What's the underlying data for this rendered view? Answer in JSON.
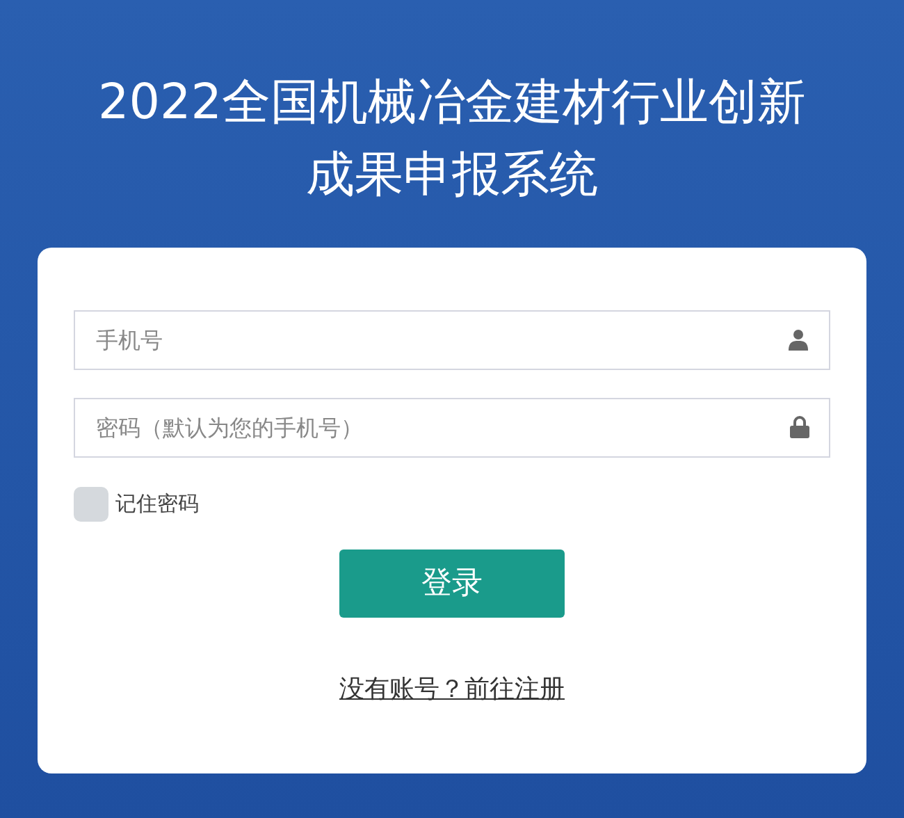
{
  "title_lines": [
    "2022全国机械冶金建材行业创新",
    "成果申报系统"
  ],
  "fields": [
    {
      "placeholder": "手机号",
      "kind": "user"
    },
    {
      "placeholder": "密码（默认为您的手机号）",
      "kind": "lock"
    }
  ],
  "remember": {
    "label": "记住密码",
    "checked": false
  },
  "login_button": "登录",
  "register_link": "没有账号？前往注册"
}
